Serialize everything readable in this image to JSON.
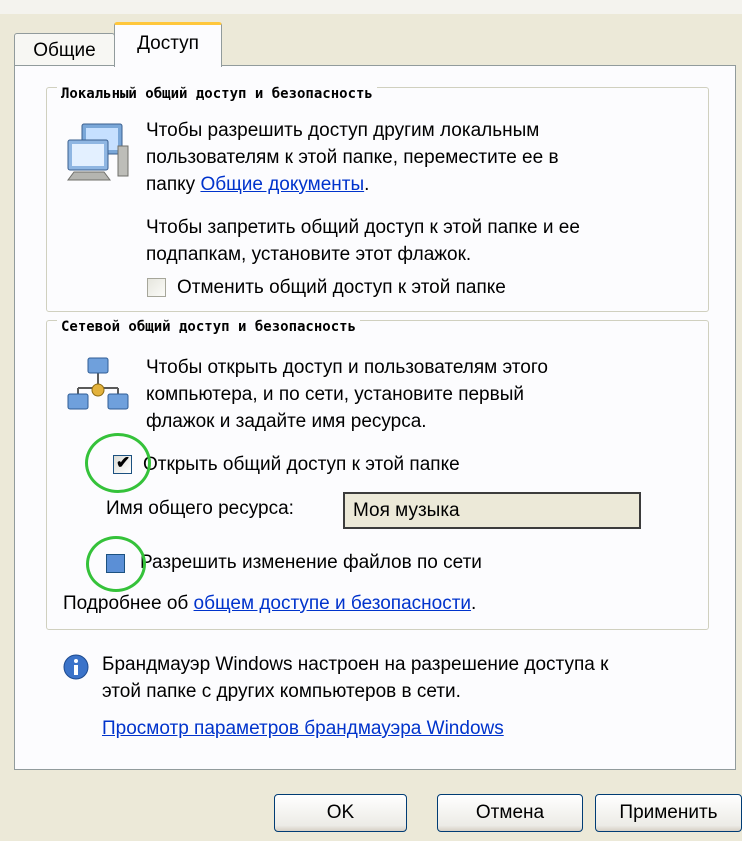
{
  "tabs": [
    {
      "label": "Общие",
      "active": false
    },
    {
      "label": "Доступ",
      "active": true
    }
  ],
  "local_group": {
    "title": "Локальный общий доступ и безопасность",
    "text_line1": "Чтобы разрешить доступ другим локальным",
    "text_line2": "пользователям к этой папке, переместите ее в",
    "text_line3_prefix": "папку ",
    "shared_docs_link": "Общие документы",
    "text_line3_suffix": ".",
    "text2_line1": "Чтобы запретить общий доступ к этой папке и ее",
    "text2_line2": "подпапкам, установите этот флажок.",
    "make_private_checkbox": {
      "label": "Отменить общий доступ к этой папке",
      "checked": false
    }
  },
  "network_group": {
    "title": "Сетевой общий доступ и безопасность",
    "text_line1": "Чтобы открыть доступ и пользователям этого",
    "text_line2": "компьютера, и по сети, установите первый",
    "text_line3": "флажок и задайте имя ресурса.",
    "share_checkbox": {
      "label": "Открыть общий доступ к этой папке",
      "checked": true
    },
    "share_name_label": "Имя общего ресурса:",
    "share_name_value": "Моя музыка",
    "allow_changes_checkbox": {
      "label": "Разрешить изменение файлов по сети",
      "checked": true
    },
    "more_info_prefix": "Подробнее об ",
    "more_info_link": "общем доступе и безопасности",
    "more_info_suffix": "."
  },
  "firewall": {
    "line1": "Брандмауэр Windows настроен на разрешение доступа к",
    "line2": "этой папке с других компьютеров в сети.",
    "link": "Просмотр параметров брандмауэра Windows"
  },
  "buttons": {
    "ok": "OK",
    "cancel": "Отмена",
    "apply": "Применить"
  },
  "colors": {
    "link": "#0033cc",
    "annotation_ring": "#35c23a",
    "tab_highlight": "#ffc73c"
  }
}
